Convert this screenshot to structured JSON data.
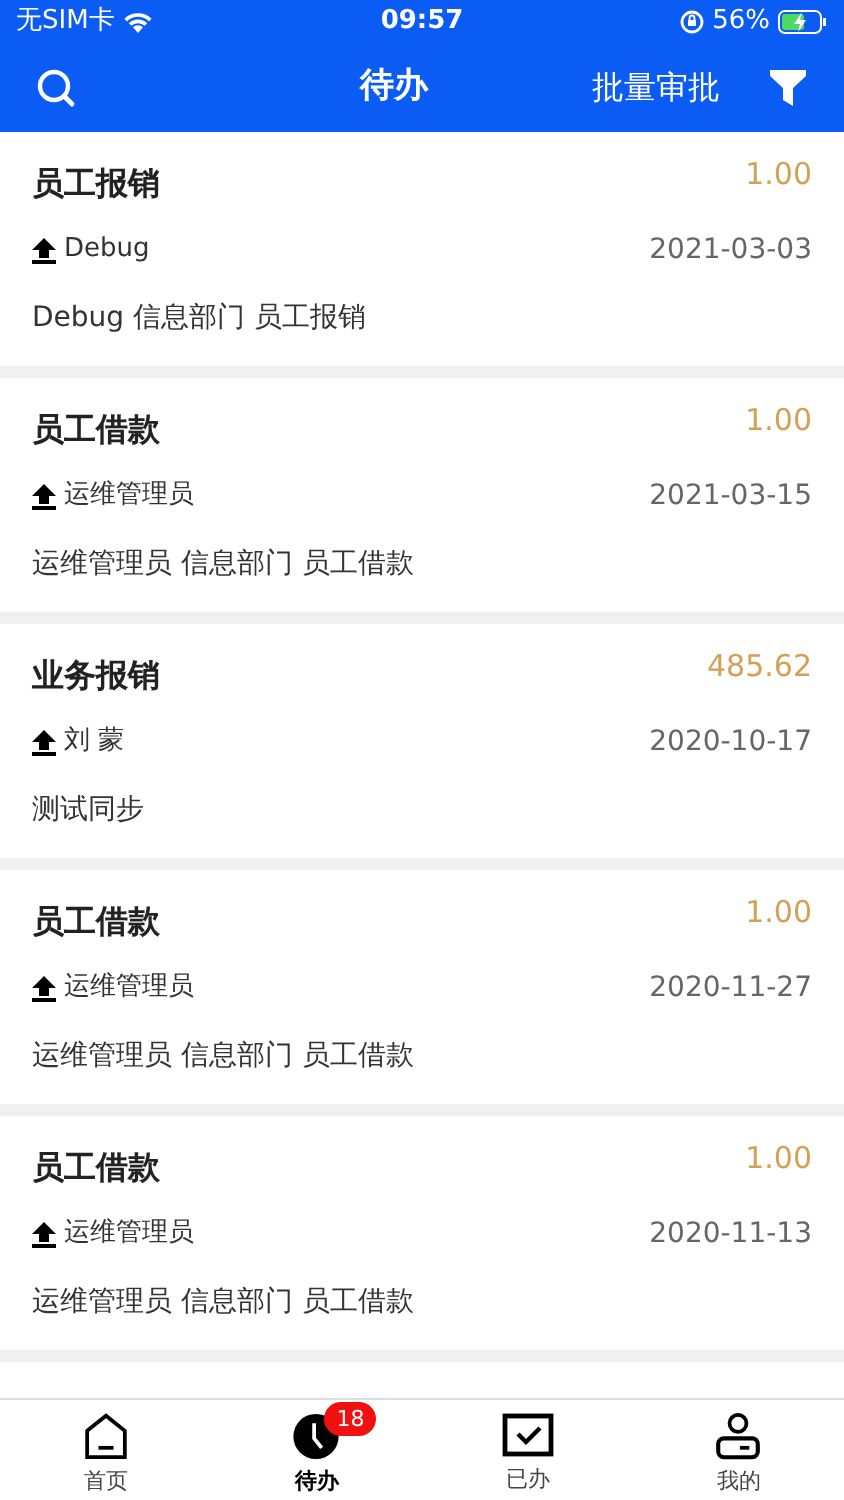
{
  "status_bar": {
    "carrier": "无SIM卡",
    "time": "09:57",
    "battery": "56%"
  },
  "header": {
    "title": "待办",
    "action": "批量审批"
  },
  "items": [
    {
      "title": "员工报销",
      "amount": "1.00",
      "submitter": "Debug",
      "date": "2021-03-03",
      "summary": "Debug 信息部门 员工报销"
    },
    {
      "title": "员工借款",
      "amount": "1.00",
      "submitter": "运维管理员",
      "date": "2021-03-15",
      "summary": "运维管理员 信息部门 员工借款"
    },
    {
      "title": "业务报销",
      "amount": "485.62",
      "submitter": "刘 蒙",
      "date": "2020-10-17",
      "summary": "测试同步"
    },
    {
      "title": "员工借款",
      "amount": "1.00",
      "submitter": "运维管理员",
      "date": "2020-11-27",
      "summary": "运维管理员 信息部门 员工借款"
    },
    {
      "title": "员工借款",
      "amount": "1.00",
      "submitter": "运维管理员",
      "date": "2020-11-13",
      "summary": "运维管理员 信息部门 员工借款"
    }
  ],
  "tabs": [
    {
      "kind": "home",
      "label": "首页",
      "selected": false
    },
    {
      "kind": "clock",
      "label": "待办",
      "selected": true,
      "badge": "18"
    },
    {
      "kind": "done",
      "label": "已办",
      "selected": false
    },
    {
      "kind": "user",
      "label": "我的",
      "selected": false
    }
  ]
}
